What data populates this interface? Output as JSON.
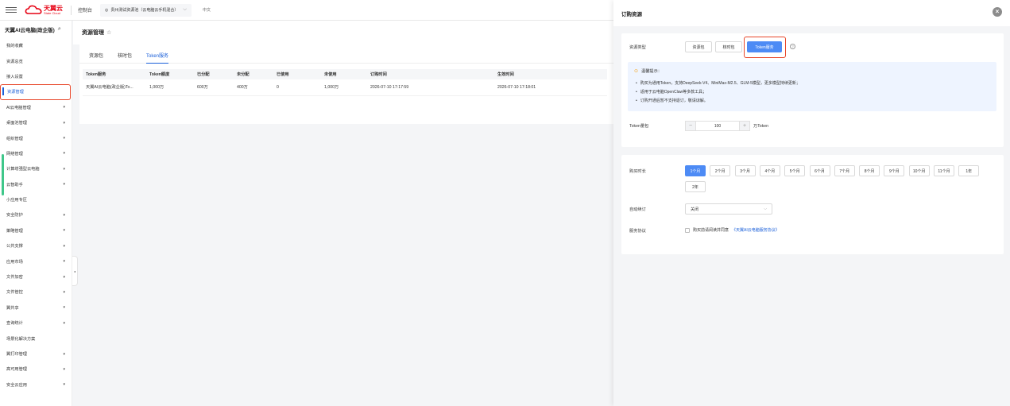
{
  "topbar": {
    "logo_cn": "天翼云",
    "logo_en": "State Cloud",
    "console": "控制台",
    "region": "贵州测试资源池（云电脑云手机混合）",
    "language": "中文"
  },
  "sidebar": {
    "title": "天翼AI云电脑(政企版)",
    "items": [
      {
        "label": "我的收藏",
        "has_arrow": false
      },
      {
        "label": "资源总览",
        "has_arrow": false
      },
      {
        "label": "接入设置",
        "has_arrow": false
      },
      {
        "label": "资源管理",
        "has_arrow": false,
        "active": true
      },
      {
        "label": "AI云电脑管理",
        "has_arrow": true
      },
      {
        "label": "桌面池管理",
        "has_arrow": true
      },
      {
        "label": "组织管理",
        "has_arrow": true
      },
      {
        "label": "网络管理",
        "has_arrow": true
      },
      {
        "label": "计算增强型云电脑",
        "has_arrow": true
      },
      {
        "label": "云智助手",
        "has_arrow": true
      },
      {
        "label": "小应用专区",
        "has_arrow": false
      },
      {
        "label": "安全防护",
        "has_arrow": true
      },
      {
        "label": "策略管理",
        "has_arrow": true
      },
      {
        "label": "公共支撑",
        "has_arrow": true
      },
      {
        "label": "应用市场",
        "has_arrow": true
      },
      {
        "label": "文件加密",
        "has_arrow": true
      },
      {
        "label": "文件管控",
        "has_arrow": true
      },
      {
        "label": "翼共享",
        "has_arrow": true
      },
      {
        "label": "查询统计",
        "has_arrow": true
      },
      {
        "label": "场景化解决方案",
        "has_arrow": false
      },
      {
        "label": "翼打印管理",
        "has_arrow": true
      },
      {
        "label": "高可用管理",
        "has_arrow": true
      },
      {
        "label": "安全云应用",
        "has_arrow": true
      }
    ]
  },
  "main": {
    "page_title": "资源管理",
    "tabs": [
      {
        "label": "资源包",
        "active": false
      },
      {
        "label": "核时包",
        "active": false
      },
      {
        "label": "Token服务",
        "active": true
      }
    ],
    "table": {
      "columns": [
        "Token服务",
        "Token额度",
        "已分配",
        "未分配",
        "已使用",
        "未使用",
        "订购时间",
        "生效时间"
      ],
      "rows": [
        [
          "天翼AI云电脑(政企版)To...",
          "1,000万",
          "600万",
          "400万",
          "0",
          "1,000万",
          "2026-07-10 17:17:59",
          "2026-07-10 17:18:01"
        ]
      ]
    }
  },
  "drawer": {
    "title": "订购资源",
    "resource_type_label": "资源类型",
    "resource_types": [
      {
        "label": "资源包",
        "selected": false
      },
      {
        "label": "核时包",
        "selected": false
      },
      {
        "label": "Token服务",
        "selected": true
      }
    ],
    "notice": {
      "title": "温馨提示：",
      "items": [
        "购买为通用Token，支持DeepSeek-V4、MiniMax-M2.5、GLM-5模型，更多模型持续更新；",
        "适用于云电脑OpenClaw等多款工具；",
        "订购开通后暂不支持退订，敬请谅解。"
      ]
    },
    "token_qty_label": "Token量包",
    "token_qty_value": "100",
    "token_qty_unit": "万Token",
    "duration_label": "购买时长",
    "durations": [
      {
        "label": "1个月",
        "selected": true
      },
      {
        "label": "2个月",
        "selected": false
      },
      {
        "label": "3个月",
        "selected": false
      },
      {
        "label": "4个月",
        "selected": false
      },
      {
        "label": "5个月",
        "selected": false
      },
      {
        "label": "6个月",
        "selected": false
      },
      {
        "label": "7个月",
        "selected": false
      },
      {
        "label": "8个月",
        "selected": false
      },
      {
        "label": "9个月",
        "selected": false
      },
      {
        "label": "10个月",
        "selected": false
      },
      {
        "label": "11个月",
        "selected": false
      },
      {
        "label": "1年",
        "selected": false
      },
      {
        "label": "2年",
        "selected": false
      }
    ],
    "auto_renew_label": "自动续订",
    "auto_renew_value": "关闭",
    "agreement_label": "服务协议",
    "agreement_text": "购买前请阅读并同意",
    "agreement_link": "《天翼AI云电脑服务协议》"
  },
  "colors": {
    "accent": "#1a5fd9",
    "selected_button": "#4d8bf5",
    "highlight_border": "#e8472a",
    "brand": "#e60012"
  }
}
